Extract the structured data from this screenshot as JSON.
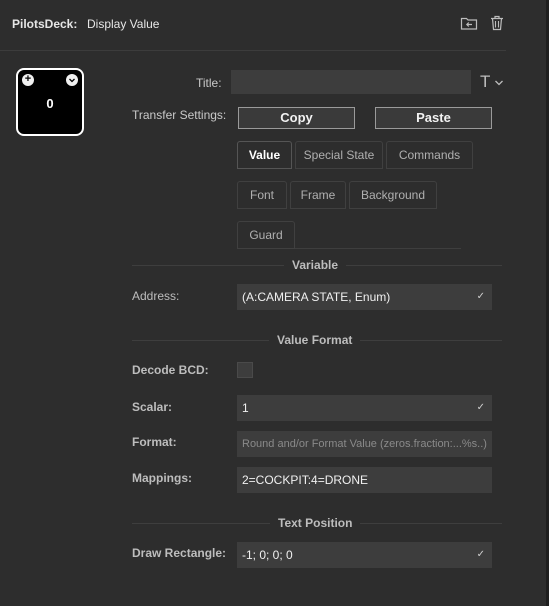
{
  "header": {
    "plugin_name": "PilotsDeck:",
    "action_name": "Display Value",
    "icons": [
      "folder-back-icon",
      "trash-icon"
    ]
  },
  "preview": {
    "value": "0",
    "plus_symbol": "+",
    "icons": [
      "plus-icon",
      "chevron-down-icon"
    ]
  },
  "title": {
    "label": "Title:",
    "value": "",
    "font_icon": "T"
  },
  "transfer": {
    "label": "Transfer Settings:",
    "copy_label": "Copy",
    "paste_label": "Paste"
  },
  "tabs": {
    "row1": [
      "Value",
      "Special State",
      "Commands"
    ],
    "row2": [
      "Font",
      "Frame",
      "Background"
    ],
    "row3": [
      "Guard"
    ],
    "active": "Value"
  },
  "variable_section": {
    "title": "Variable",
    "address_label": "Address:",
    "address_value": "(A:CAMERA STATE, Enum)"
  },
  "value_format": {
    "title": "Value Format",
    "decode_bcd_label": "Decode BCD:",
    "decode_bcd_checked": false,
    "scalar_label": "Scalar:",
    "scalar_value": "1",
    "format_label": "Format:",
    "format_placeholder": "Round and/or Format Value (zeros.fraction:...%s..)",
    "format_value": "",
    "mappings_label": "Mappings:",
    "mappings_value": "2=COCKPIT:4=DRONE"
  },
  "text_position": {
    "title": "Text Position",
    "draw_rect_label": "Draw Rectangle:",
    "draw_rect_value": "-1; 0; 0; 0"
  },
  "colors": {
    "background": "#2d2d2d",
    "input_bg": "#3d3d3d",
    "button_border": "#9a9a9a",
    "text": "#d0d0d0"
  }
}
